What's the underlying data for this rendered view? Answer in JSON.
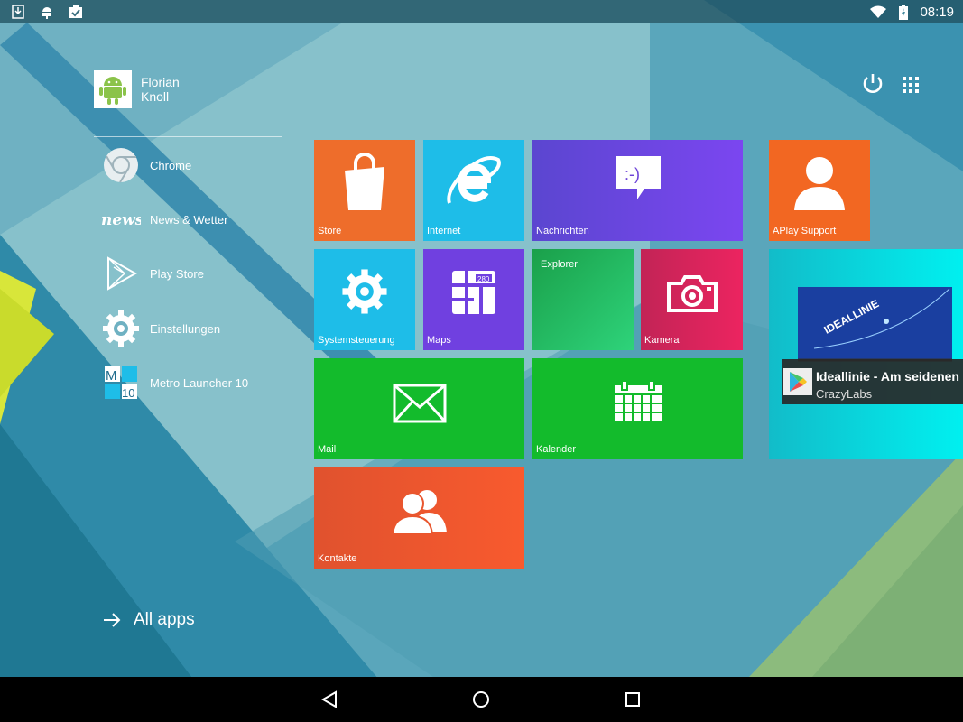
{
  "status_bar": {
    "time": "08:19",
    "left_icons": [
      "download-icon",
      "android-debug-icon",
      "clipboard-check-icon"
    ],
    "right_icons": [
      "wifi-icon",
      "battery-charging-icon"
    ]
  },
  "profile": {
    "first_name": "Florian",
    "last_name": "Knoll"
  },
  "header_actions": [
    "power-icon",
    "grid-icon"
  ],
  "app_list": [
    {
      "label": "Chrome",
      "icon": "chrome-icon"
    },
    {
      "label": "News & Wetter",
      "icon": "news-icon"
    },
    {
      "label": "Play Store",
      "icon": "play-store-icon"
    },
    {
      "label": "Einstellungen",
      "icon": "settings-icon"
    },
    {
      "label": "Metro Launcher 10",
      "icon": "metro-launcher-icon"
    }
  ],
  "all_apps_label": "All apps",
  "tiles": {
    "store": {
      "label": "Store",
      "color": "#ee6d2b"
    },
    "internet": {
      "label": "Internet",
      "color": "#1ebde8"
    },
    "nachrichten": {
      "label": "Nachrichten",
      "color": "#6d44d7"
    },
    "aplay": {
      "label": "APlay Support",
      "color": "#f26722"
    },
    "systemsteuerung": {
      "label": "Systemsteuerung",
      "color": "#1ebde8"
    },
    "maps": {
      "label": "Maps",
      "color": "#7040e0"
    },
    "explorer": {
      "label": "Explorer",
      "color": "#22c06a"
    },
    "kamera": {
      "label": "Kamera",
      "color": "#e0245a"
    },
    "mail": {
      "label": "Mail",
      "color": "#13bb2c"
    },
    "kalender": {
      "label": "Kalender",
      "color": "#13bb2c"
    },
    "kontakte": {
      "label": "Kontakte",
      "color": "#f0522e"
    },
    "promo": {
      "banner_text": "IDEALLINIE"
    }
  },
  "notification": {
    "title": "Ideallinie - Am seidenen",
    "subtitle": "CrazyLabs",
    "icon": "play-store-icon"
  },
  "nav_bar": [
    "back-icon",
    "home-icon",
    "recents-icon"
  ]
}
